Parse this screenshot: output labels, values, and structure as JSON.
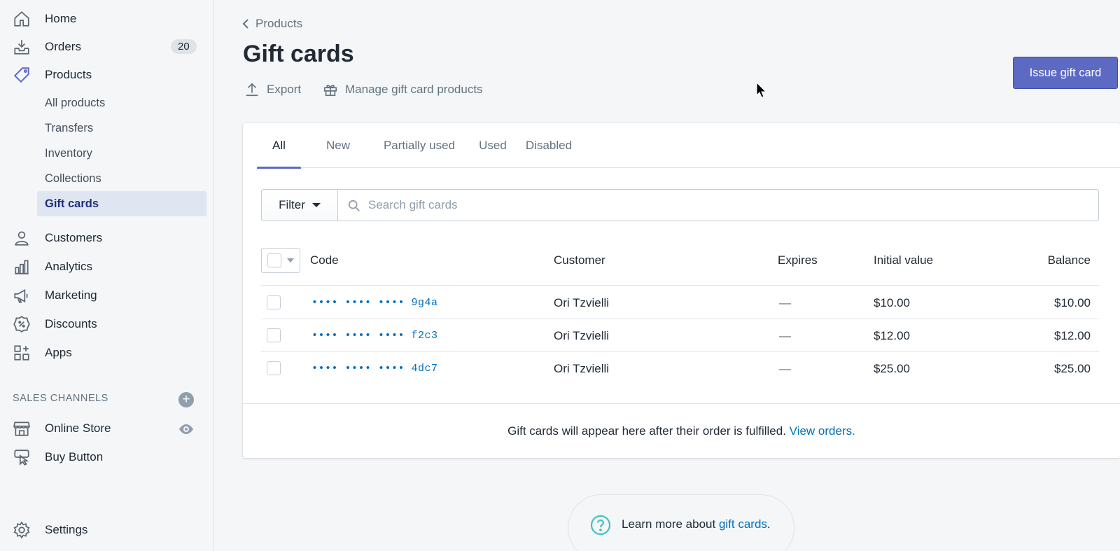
{
  "sidebar": {
    "nav": [
      {
        "label": "Home",
        "icon": "home-icon"
      },
      {
        "label": "Orders",
        "icon": "orders-icon",
        "badge": "20"
      },
      {
        "label": "Products",
        "icon": "tag-icon"
      }
    ],
    "products_sub": [
      "All products",
      "Transfers",
      "Inventory",
      "Collections",
      "Gift cards"
    ],
    "nav2": [
      {
        "label": "Customers",
        "icon": "customers-icon"
      },
      {
        "label": "Analytics",
        "icon": "analytics-icon"
      },
      {
        "label": "Marketing",
        "icon": "marketing-icon"
      },
      {
        "label": "Discounts",
        "icon": "discounts-icon"
      },
      {
        "label": "Apps",
        "icon": "apps-icon"
      }
    ],
    "sales_channels_header": "SALES CHANNELS",
    "channels": [
      {
        "label": "Online Store",
        "icon": "store-icon"
      },
      {
        "label": "Buy Button",
        "icon": "buy-button-icon"
      }
    ],
    "settings": "Settings"
  },
  "header": {
    "breadcrumb": "Products",
    "title": "Gift cards",
    "export": "Export",
    "manage": "Manage gift card products",
    "issue_button": "Issue gift card"
  },
  "tabs": [
    "All",
    "New",
    "Partially used",
    "Used",
    "Disabled"
  ],
  "filter": {
    "button": "Filter",
    "placeholder": "Search gift cards"
  },
  "table": {
    "columns": [
      "Code",
      "Customer",
      "Expires",
      "Initial value",
      "Balance"
    ],
    "rows": [
      {
        "code": "•••• •••• •••• 9g4a",
        "customer": "Ori Tzvielli",
        "expires": "—",
        "initial": "$10.00",
        "balance": "$10.00"
      },
      {
        "code": "•••• •••• •••• f2c3",
        "customer": "Ori Tzvielli",
        "expires": "—",
        "initial": "$12.00",
        "balance": "$12.00"
      },
      {
        "code": "•••• •••• •••• 4dc7",
        "customer": "Ori Tzvielli",
        "expires": "—",
        "initial": "$25.00",
        "balance": "$25.00"
      }
    ]
  },
  "footer_note": {
    "text": "Gift cards will appear here after their order is fulfilled.",
    "link": "View orders."
  },
  "learn_more": {
    "text": "Learn more about",
    "link": "gift cards",
    "suffix": "."
  },
  "colors": {
    "primary": "#5c6ac4",
    "link": "#006fbb",
    "active_nav_bg": "#dfe5f1"
  }
}
